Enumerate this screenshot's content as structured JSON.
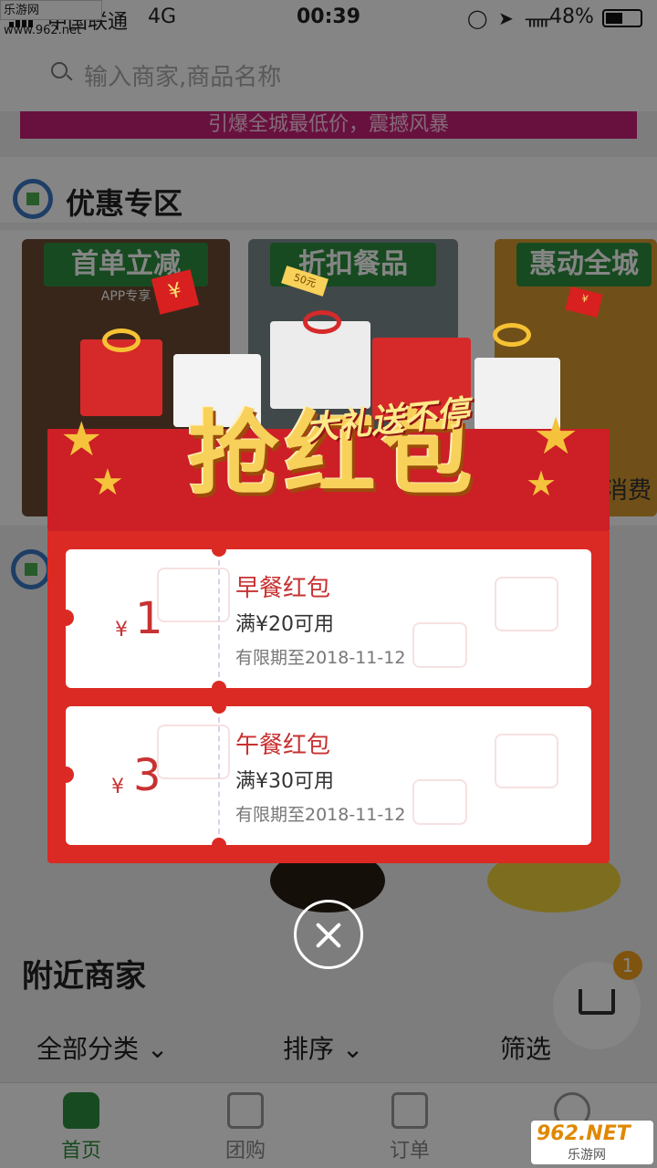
{
  "watermark_top": "乐游网 www.962.net",
  "status_bar": {
    "carrier": "中国联通",
    "network": "4G",
    "time": "00:39",
    "battery": "48%"
  },
  "search": {
    "placeholder": "输入商家,商品名称"
  },
  "banner": {
    "text": "引爆全城最低价，震撼风暴"
  },
  "discount_section": {
    "title": "优惠专区",
    "cards": [
      {
        "label": "首单立减",
        "sub": "APP专享",
        "tail": ""
      },
      {
        "label": "折扣餐品",
        "sub": "",
        "tail": ""
      },
      {
        "label": "惠动全城",
        "sub": "",
        "tail": "消费"
      }
    ]
  },
  "popup": {
    "title": "抢红包",
    "slogan": "大礼送不停",
    "tag_coin": "50元",
    "coupons": [
      {
        "currency": "¥",
        "amount": "1",
        "name": "早餐红包",
        "condition": "满¥20可用",
        "validity": "有限期至2018-11-12"
      },
      {
        "currency": "¥",
        "amount": "3",
        "name": "午餐红包",
        "condition": "满¥30可用",
        "validity": "有限期至2018-11-12"
      }
    ]
  },
  "nearby": {
    "title": "附近商家"
  },
  "filters": [
    {
      "label": "全部分类"
    },
    {
      "label": "排序"
    },
    {
      "label": "筛选"
    }
  ],
  "cart": {
    "count": "1"
  },
  "tabs": [
    {
      "label": "首页"
    },
    {
      "label": "团购"
    },
    {
      "label": "订单"
    },
    {
      "label": ""
    }
  ],
  "watermark_bottom": {
    "brand": "962.NET",
    "sub": "乐游网"
  },
  "colors": {
    "accent": "#2d8f3e",
    "popup_red": "#da2a23",
    "gold": "#f7d15a",
    "badge": "#f3a21b"
  }
}
